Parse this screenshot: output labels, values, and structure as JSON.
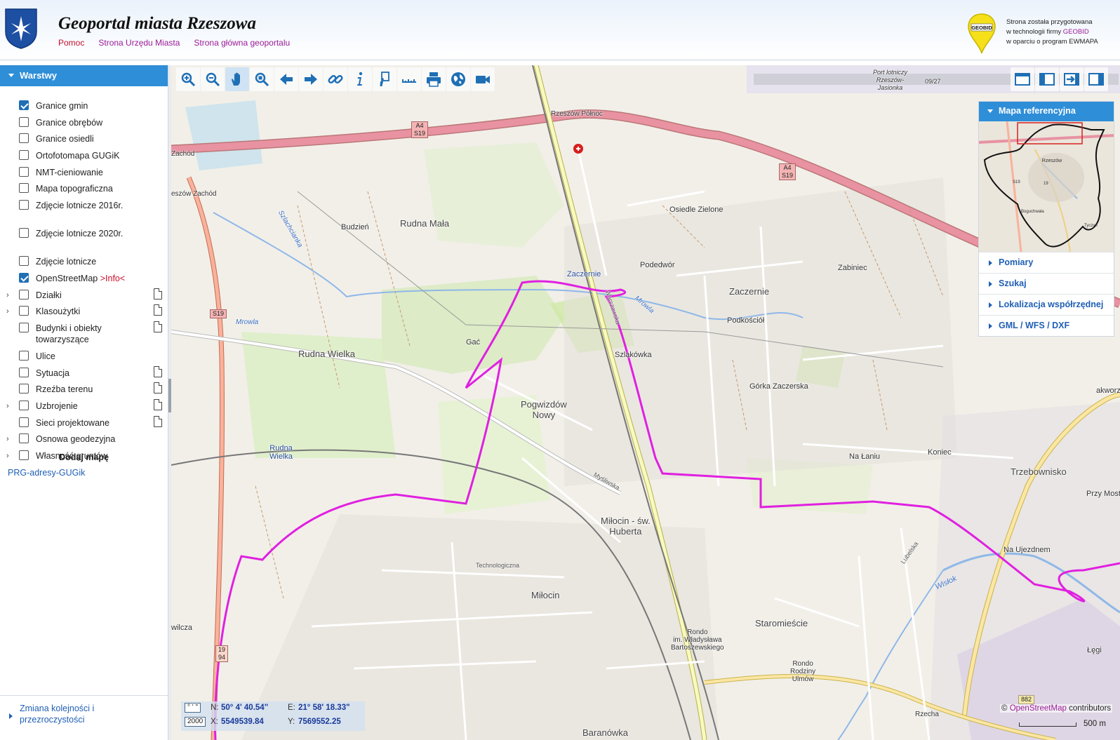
{
  "header": {
    "title": "Geoportal miasta Rzeszowa",
    "links": {
      "help": "Pomoc",
      "city_hall": "Strona Urzędu Miasta",
      "main_page": "Strona główna geoportalu"
    },
    "geobid": {
      "logo_text": "GEOBID",
      "line1": "Strona została przygotowana",
      "line2_prefix": "w technologii firmy",
      "line2_brand": "GEOBID",
      "line3": "w oparciu o program EWMAPA"
    }
  },
  "layers_panel": {
    "title": "Warstwy",
    "items": [
      {
        "label": "Granice gmin",
        "checked": true
      },
      {
        "label": "Granice obrębów",
        "checked": false
      },
      {
        "label": "Granice osiedli",
        "checked": false
      },
      {
        "label": "Ortofotomapa GUGiK",
        "checked": false
      },
      {
        "label": "NMT-cieniowanie",
        "checked": false
      },
      {
        "label": "Mapa topograficzna",
        "checked": false
      },
      {
        "label": "Zdjęcie lotnicze 2016r.",
        "checked": false
      },
      {
        "label": "Zdjęcie lotnicze 2020r.",
        "checked": false
      },
      {
        "label": "Zdjęcie lotnicze",
        "checked": false
      },
      {
        "label": "OpenStreetMap",
        "info": ">Info<",
        "checked": true
      },
      {
        "label": "Działki",
        "checked": false,
        "expandable": true,
        "doc": true
      },
      {
        "label": "Klasoużytki",
        "checked": false,
        "expandable": true,
        "doc": true
      },
      {
        "label": "Budynki i obiekty towarzyszące",
        "checked": false,
        "doc": true
      },
      {
        "label": "Ulice",
        "checked": false
      },
      {
        "label": "Sytuacja",
        "checked": false,
        "doc": true
      },
      {
        "label": "Rzeźba terenu",
        "checked": false,
        "doc": true
      },
      {
        "label": "Uzbrojenie",
        "checked": false,
        "expandable": true,
        "doc": true
      },
      {
        "label": "Sieci projektowane",
        "checked": false,
        "doc": true
      },
      {
        "label": "Osnowa geodezyjna",
        "checked": false,
        "expandable": true
      },
      {
        "label": "Własność gruntów",
        "checked": false,
        "expandable": true
      }
    ],
    "add_map_title": "Dodaj mapę",
    "add_map_link": "PRG-adresy-GUGik",
    "order_footer": "Zmiana kolejności i przezroczystości"
  },
  "toolbar": {
    "tools": [
      "zoom-in-icon",
      "zoom-out-icon",
      "pan-hand-icon",
      "zoom-box-icon",
      "back-arrow-icon",
      "forward-arrow-icon",
      "link-icon",
      "info-icon",
      "info-doc-icon",
      "measure-icon",
      "print-icon",
      "globe-icon",
      "camera-icon"
    ],
    "active_tool": "pan-hand-icon",
    "view_buttons": [
      "top-panel-icon",
      "left-panel-icon",
      "exit-panel-icon",
      "right-panel-icon"
    ]
  },
  "ref_panel": {
    "title": "Mapa referencyjna",
    "ref_labels": {
      "city": "Rzeszów",
      "road": "S19",
      "road2": "19",
      "south": "Boguchwała",
      "east": "Tyczyn"
    },
    "accordions": [
      "Pomiary",
      "Szukaj",
      "Lokalizacja współrzędnej",
      "GML / WFS / DXF"
    ]
  },
  "map": {
    "places": {
      "rudna_mala": "Rudna Mała",
      "rudna_wielka": "Rudna Wielka",
      "rudna_wielka_stop": "Rudna\nWielka",
      "budzien": "Budzień",
      "zaczernie": "Zaczernie",
      "zaczernie_station": "Zaczernie",
      "podedwor": "Podedwór",
      "zabiniec": "Zabiniec",
      "osiedle_zielone": "Osiedle Zielone",
      "podkoscio": "Podkościół",
      "szlakowka": "Szlakówka",
      "gorka": "Górka Zaczerska",
      "gac": "Gać",
      "pogwizdow": "Pogwizdów\nNowy",
      "milocin_sw": "Miłocin - św.\nHuberta",
      "milocin": "Miłocin",
      "staromiescie": "Staromieście",
      "baranowka": "Baranówka",
      "na_laniu": "Na Łaniu",
      "koniec": "Koniec",
      "trzebownisko": "Trzebownisko",
      "przy_most": "Przy Most",
      "na_ujezdnem": "Na Ujezdnem",
      "rondo_bart": "Rondo\nim. Władysława\nBartoszewskiego",
      "rondo_ulmow": "Rondo\nRodziny\nUlmów",
      "rzeszow_polnoc": "Rzeszów Północ",
      "rzeszow_zachod": "eszów Zachód",
      "zachod": "Zachód",
      "port": "Port lotniczy\nRzeszów-\nJasionka",
      "legi": "Łęgi",
      "wilcza": "wilcza",
      "akworze": "akworze",
      "runway": "09/27",
      "mrowla": "Mrowla",
      "mrowla2": "Mrowla",
      "szlachcianka": "Szlachcianka",
      "wislok": "Wisłok",
      "rzecha": "Rzecha",
      "warszawska": "Warszawska",
      "mysliwska": "Myśliwska",
      "technologiczna": "Technologiczna",
      "lubelska": "Lubelska"
    },
    "shields": {
      "a4_1": "A4\nS19",
      "a4_2": "A4\nS19",
      "s19": "S19",
      "r19": "19\n94",
      "r882": "882"
    },
    "attribution_prefix": "©",
    "attribution_link": "OpenStreetMap",
    "attribution_suffix": "contributors",
    "scale_label": "500 m"
  },
  "coords": {
    "unit_deg": "° ' \"",
    "unit_num": "2000",
    "n_label": "N:",
    "n_value": "50° 4' 40.54\"",
    "e_label": "E:",
    "e_value": "21° 58' 18.33\"",
    "x_label": "X:",
    "x_value": "5549539.84",
    "y_label": "Y:",
    "y_value": "7569552.25"
  },
  "colors": {
    "accent_blue": "#2f8ed8",
    "boundary_magenta": "#e020e0",
    "motorway_pink": "#e892a2",
    "help_red": "#c8102e",
    "link_purple": "#9b1c98"
  }
}
